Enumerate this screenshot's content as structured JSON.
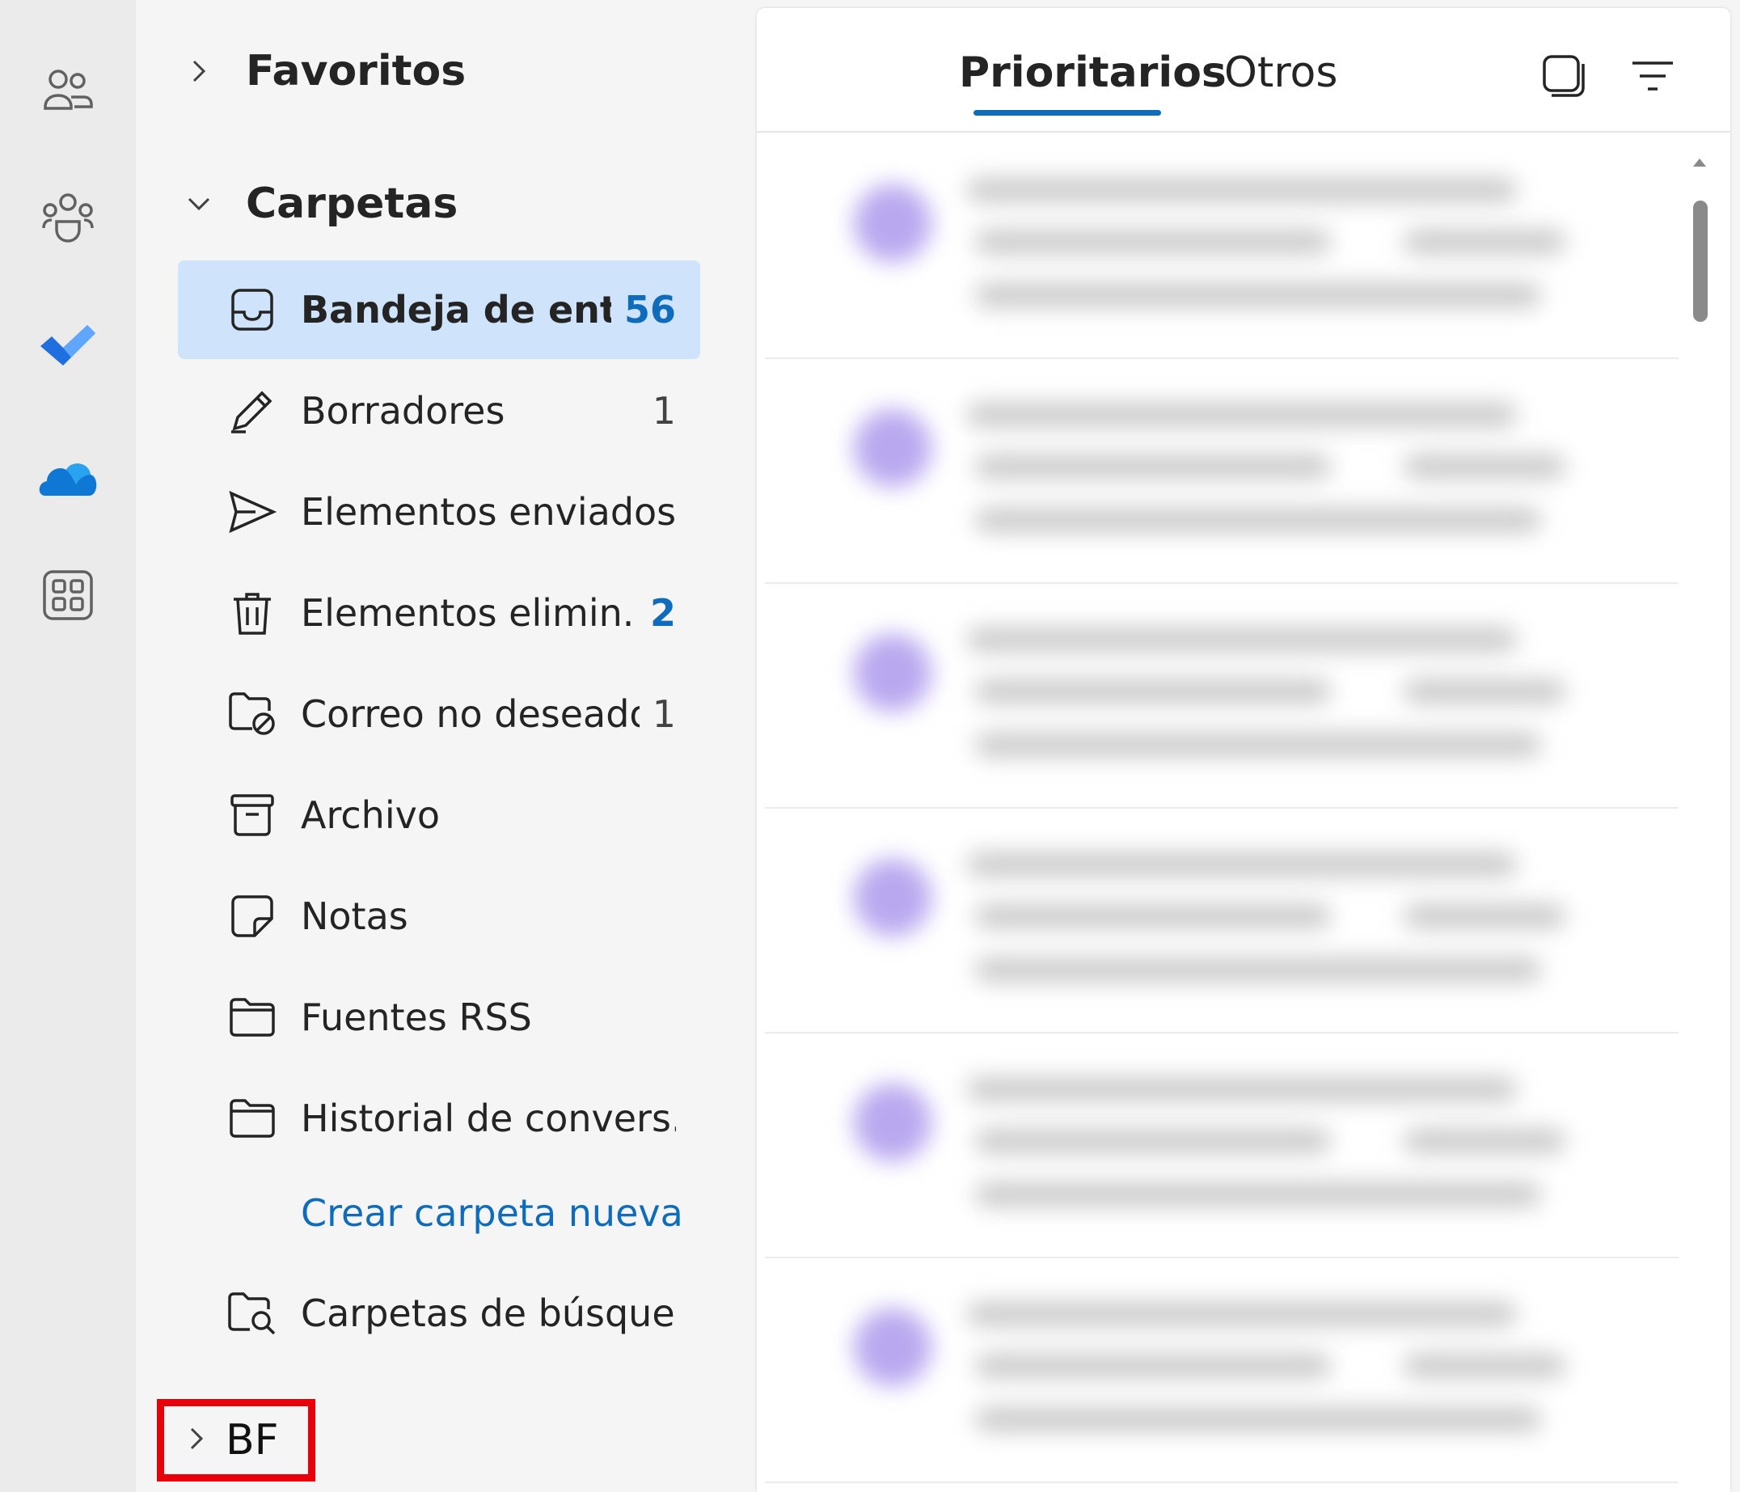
{
  "rail": {
    "items": [
      {
        "icon": "people-icon"
      },
      {
        "icon": "groups-icon"
      },
      {
        "icon": "todo-check-icon"
      },
      {
        "icon": "onedrive-cloud-icon"
      },
      {
        "icon": "apps-grid-icon"
      }
    ]
  },
  "folders": {
    "favoritos_label": "Favoritos",
    "carpetas_label": "Carpetas",
    "items": [
      {
        "label": "Bandeja de ent...",
        "count": "56",
        "icon": "inbox-icon",
        "selected": true
      },
      {
        "label": "Borradores",
        "count": "1",
        "icon": "drafts-pencil-icon"
      },
      {
        "label": "Elementos enviados",
        "count": "",
        "icon": "send-icon"
      },
      {
        "label": "Elementos elimin...",
        "count": "2",
        "icon": "trash-icon"
      },
      {
        "label": "Correo no deseado",
        "count": "1",
        "icon": "junk-folder-icon"
      },
      {
        "label": "Archivo",
        "count": "",
        "icon": "archive-icon"
      },
      {
        "label": "Notas",
        "count": "",
        "icon": "note-icon"
      },
      {
        "label": "Fuentes RSS",
        "count": "",
        "icon": "folder-icon"
      },
      {
        "label": "Historial de convers...",
        "count": "",
        "icon": "folder-icon"
      },
      {
        "label": "Carpetas de búsque...",
        "count": "",
        "icon": "search-folder-icon"
      }
    ],
    "create_folder_label": "Crear carpeta nueva",
    "account_label": "BF"
  },
  "message_list": {
    "tabs": [
      {
        "label": "Prioritarios",
        "active": true
      },
      {
        "label": "Otros",
        "active": false
      }
    ],
    "header_icons": [
      "select-mode-icon",
      "filter-icon"
    ]
  },
  "colors": {
    "accent": "#0f6cbd",
    "selected_bg": "#cfe4fa",
    "highlight_box": "#e8000b"
  }
}
